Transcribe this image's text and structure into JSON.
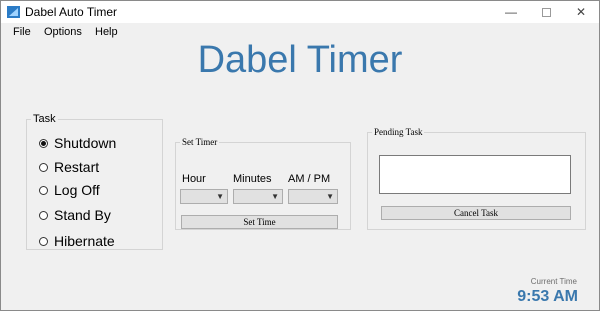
{
  "window": {
    "title": "Dabel Auto Timer"
  },
  "menu": {
    "items": [
      "File",
      "Options",
      "Help"
    ]
  },
  "headline": "Dabel Timer",
  "task": {
    "legend": "Task",
    "options": [
      "Shutdown",
      "Restart",
      "Log Off",
      "Stand By",
      "Hibernate"
    ],
    "selected": "Shutdown"
  },
  "set_timer": {
    "legend": "Set Timer",
    "hour_label": "Hour",
    "minutes_label": "Minutes",
    "ampm_label": "AM / PM",
    "hour_value": "",
    "minutes_value": "",
    "ampm_value": "",
    "button": "Set Time"
  },
  "pending": {
    "legend": "Pending Task",
    "text": "",
    "button": "Cancel Task"
  },
  "clock": {
    "label": "Current Time",
    "value": "9:53 AM"
  },
  "colors": {
    "accent": "#3a78ad",
    "background": "#f0f0f0"
  }
}
